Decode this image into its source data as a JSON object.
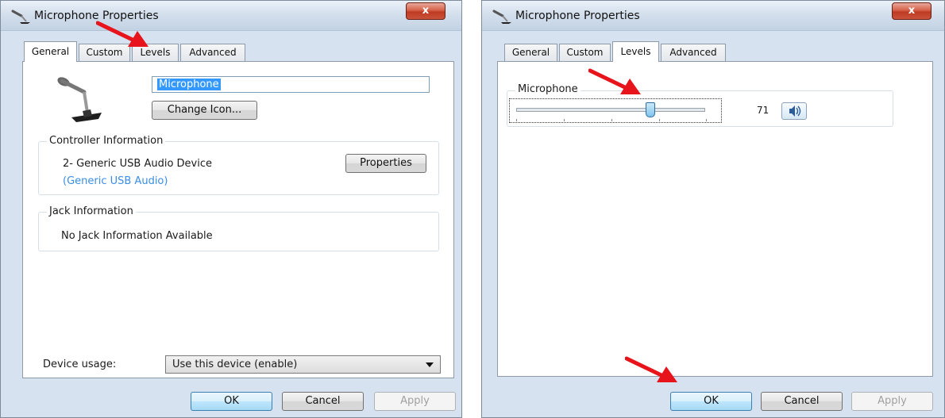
{
  "left_dialog": {
    "title": "Microphone Properties",
    "close_label": "x",
    "tabs": [
      {
        "label": "General",
        "active": true
      },
      {
        "label": "Custom",
        "active": false
      },
      {
        "label": "Levels",
        "active": false
      },
      {
        "label": "Advanced",
        "active": false
      }
    ],
    "device_name": "Microphone",
    "change_icon_label": "Change Icon...",
    "controller_group_label": "Controller Information",
    "controller_name": "2- Generic USB Audio Device",
    "controller_driver": "(Generic USB Audio)",
    "properties_label": "Properties",
    "jack_group_label": "Jack Information",
    "jack_text": "No Jack Information Available",
    "device_usage_label": "Device usage:",
    "device_usage_value": "Use this device (enable)",
    "ok_label": "OK",
    "cancel_label": "Cancel",
    "apply_label": "Apply"
  },
  "right_dialog": {
    "title": "Microphone Properties",
    "close_label": "x",
    "tabs": [
      {
        "label": "General",
        "active": false
      },
      {
        "label": "Custom",
        "active": false
      },
      {
        "label": "Levels",
        "active": true
      },
      {
        "label": "Advanced",
        "active": false
      }
    ],
    "level_group_label": "Microphone",
    "level_value": "71",
    "level_fraction": 0.71,
    "ok_label": "OK",
    "cancel_label": "Cancel",
    "apply_label": "Apply"
  },
  "colors": {
    "annotation_arrow": "#e8141c",
    "selection": "#3399ff",
    "link": "#3a8ee6"
  },
  "icons": {
    "title": "microphone-icon",
    "close": "close-icon",
    "speaker": "speaker-icon",
    "annotation": "red-arrow"
  }
}
